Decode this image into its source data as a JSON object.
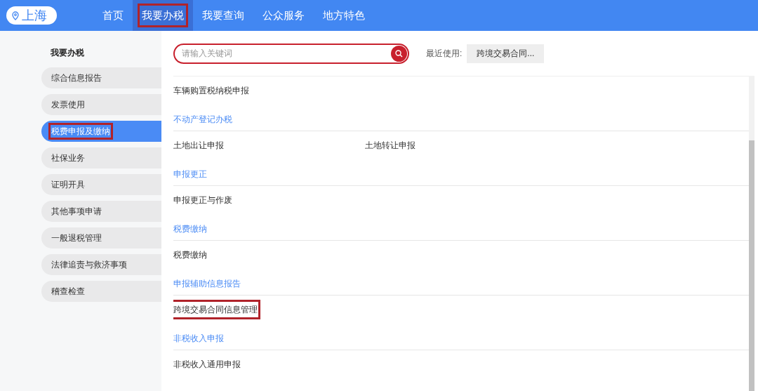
{
  "location": "上海",
  "nav": [
    {
      "label": "首页",
      "selected": false,
      "annotated": false
    },
    {
      "label": "我要办税",
      "selected": true,
      "annotated": true
    },
    {
      "label": "我要查询",
      "selected": false,
      "annotated": false
    },
    {
      "label": "公众服务",
      "selected": false,
      "annotated": false
    },
    {
      "label": "地方特色",
      "selected": false,
      "annotated": false
    }
  ],
  "sidebar": {
    "title": "我要办税",
    "items": [
      {
        "label": "综合信息报告",
        "selected": false,
        "annotated": false
      },
      {
        "label": "发票使用",
        "selected": false,
        "annotated": false
      },
      {
        "label": "税费申报及缴纳",
        "selected": true,
        "annotated": true
      },
      {
        "label": "社保业务",
        "selected": false,
        "annotated": false
      },
      {
        "label": "证明开具",
        "selected": false,
        "annotated": false
      },
      {
        "label": "其他事项申请",
        "selected": false,
        "annotated": false
      },
      {
        "label": "一般退税管理",
        "selected": false,
        "annotated": false
      },
      {
        "label": "法律追责与救济事项",
        "selected": false,
        "annotated": false
      },
      {
        "label": "稽查检查",
        "selected": false,
        "annotated": false
      }
    ]
  },
  "search": {
    "placeholder": "请输入关键词"
  },
  "recent": {
    "label": "最近使用:",
    "items": [
      "跨境交易合同..."
    ]
  },
  "sections": [
    {
      "items": [
        {
          "label": "车辆购置税纳税申报",
          "annotated": false
        }
      ]
    },
    {
      "title": "不动产登记办税",
      "items": [
        {
          "label": "土地出让申报",
          "annotated": false
        },
        {
          "label": "土地转让申报",
          "annotated": false
        }
      ]
    },
    {
      "title": "申报更正",
      "items": [
        {
          "label": "申报更正与作废",
          "annotated": false
        }
      ]
    },
    {
      "title": "税费缴纳",
      "items": [
        {
          "label": "税费缴纳",
          "annotated": false
        }
      ]
    },
    {
      "title": "申报辅助信息报告",
      "items": [
        {
          "label": "跨境交易合同信息管理",
          "annotated": true
        }
      ]
    },
    {
      "title": "非税收入申报",
      "items": [
        {
          "label": "非税收入通用申报",
          "annotated": false
        }
      ]
    }
  ]
}
